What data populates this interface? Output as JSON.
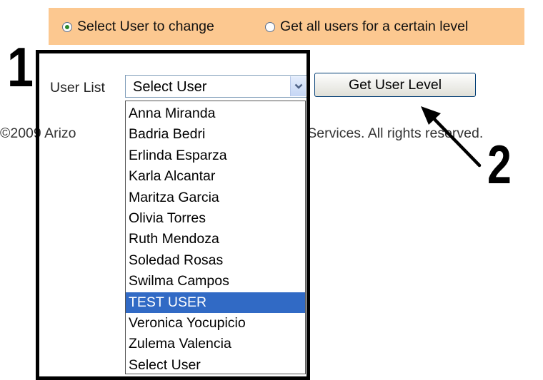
{
  "mode_selector": {
    "options": [
      {
        "label": "Select User to change",
        "checked": true
      },
      {
        "label": "Get all users for a certain level",
        "checked": false
      }
    ]
  },
  "form": {
    "user_list_label": "User List",
    "select_value": "Select User",
    "get_level_button": "Get User Level"
  },
  "dropdown": {
    "items": [
      "Anna Miranda",
      "Badria Bedri",
      "Erlinda Esparza",
      "Karla Alcantar",
      "Maritza Garcia",
      "Olivia Torres",
      "Ruth Mendoza",
      "Soledad Rosas",
      "Swilma Campos",
      "TEST USER",
      "Veronica Yocupicio",
      "Zulema Valencia",
      "Select User"
    ],
    "highlighted": "TEST USER"
  },
  "footer": {
    "visible_left": "©2009 Arizo",
    "visible_right": "n Services. All rights reserved."
  },
  "annotations": {
    "box_label": "1",
    "arrow_label": "2"
  },
  "colors": {
    "radio_bar_bg": "#fcc890",
    "highlight": "#316ac5"
  }
}
